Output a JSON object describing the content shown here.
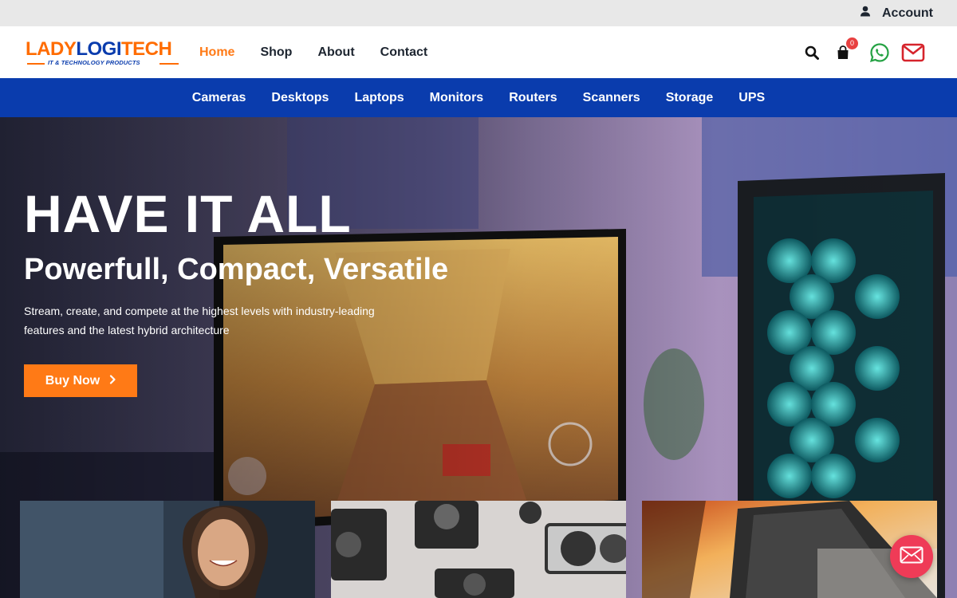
{
  "topbar": {
    "account_label": "Account",
    "account_icon": "user-icon"
  },
  "logo": {
    "part1": "LADY",
    "part2": "LOGI",
    "part3": "TECH",
    "tagline": "IT & TECHNOLOGY PRODUCTS"
  },
  "mainnav": {
    "items": [
      {
        "label": "Home",
        "active": true
      },
      {
        "label": "Shop",
        "active": false
      },
      {
        "label": "About",
        "active": false
      },
      {
        "label": "Contact",
        "active": false
      }
    ]
  },
  "header_icons": {
    "search": "search-icon",
    "cart": "shopping-bag-icon",
    "cart_count": "0",
    "whatsapp": "whatsapp-icon",
    "email": "envelope-icon"
  },
  "categories": [
    "Cameras",
    "Desktops",
    "Laptops",
    "Monitors",
    "Routers",
    "Scanners",
    "Storage",
    "UPS"
  ],
  "hero": {
    "title": "HAVE IT ALL",
    "subtitle": "Powerfull, Compact, Versatile",
    "description": "Stream, create, and compete at the highest levels with industry-leading features and the latest hybrid architecture",
    "button_label": "Buy Now",
    "button_icon": "chevron-right-icon"
  },
  "floating_contact": {
    "icon": "envelope-icon"
  },
  "colors": {
    "accent_orange": "#ff7a16",
    "brand_blue": "#0a3cad",
    "topbar_bg": "#e8e8e8",
    "cart_badge": "#e84040",
    "whatsapp_green": "#25a244",
    "email_red": "#d6242c",
    "float_button": "#ef3b57"
  }
}
